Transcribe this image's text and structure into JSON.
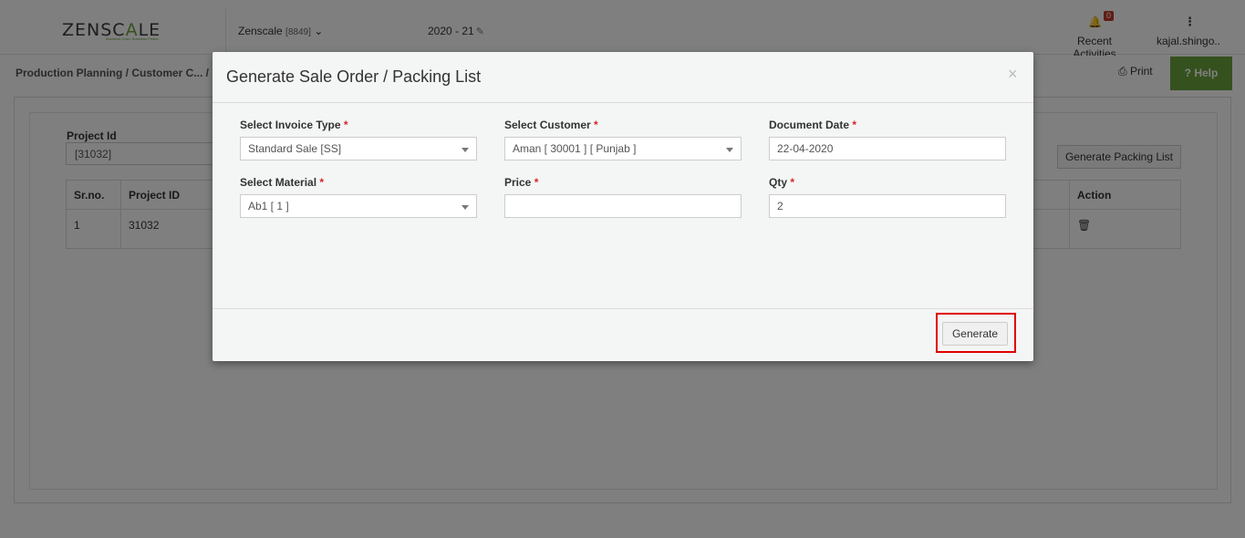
{
  "header": {
    "logo_left": "ZENSC",
    "logo_accent": "A",
    "logo_right": "LE",
    "logo_tagline": "Business Cash. Business Peace.",
    "company": "Zenscale",
    "company_code": "[8849]",
    "financial_year": "2020 - 21",
    "notification_count": "0",
    "recent_activities": "Recent Activities",
    "user": "kajal.shingo.."
  },
  "breadcrumb": "Production Planning  / Customer C... / Pr",
  "toolbar": {
    "print": "Print",
    "help": "Help"
  },
  "page": {
    "project_id_label": "Project Id",
    "project_id_value": "[31032]",
    "generate_packing_label": "Generate Packing List",
    "table": {
      "columns": [
        "Sr.no.",
        "Project ID",
        "Action"
      ],
      "rows": [
        {
          "srno": "1",
          "project_id": "31032"
        }
      ]
    }
  },
  "modal": {
    "title": "Generate Sale Order / Packing List",
    "close": "×",
    "fields": {
      "invoice_type": {
        "label": "Select Invoice Type",
        "value": "Standard Sale [SS]"
      },
      "customer": {
        "label": "Select Customer",
        "value": "Aman [ 30001 ] [ Punjab ]"
      },
      "document_date": {
        "label": "Document Date",
        "value": "22-04-2020"
      },
      "material": {
        "label": "Select Material",
        "value": "Ab1 [ 1 ]"
      },
      "price": {
        "label": "Price",
        "value": ""
      },
      "qty": {
        "label": "Qty",
        "value": "2"
      }
    },
    "required_mark": "*",
    "generate_label": "Generate"
  },
  "colors": {
    "accent": "#6aa33c",
    "highlight": "#e00000",
    "required": "#d9232d"
  },
  "icons": [
    "chevron-down-icon",
    "edit-icon",
    "bell-icon",
    "kebab-icon",
    "print-icon",
    "help-icon",
    "trash-icon",
    "close-icon"
  ]
}
